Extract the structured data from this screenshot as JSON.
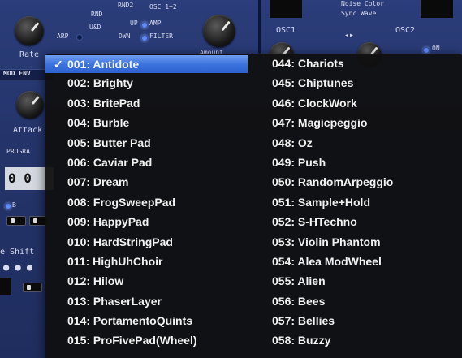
{
  "synth": {
    "rate_label": "Rate",
    "arp_label": "ARP",
    "rnd_label": "RND",
    "rnd2_label": "RND2",
    "osc12_label": "OSC 1+2",
    "ud_label": "U&D",
    "up_label": "UP",
    "amp_label": "AMP",
    "dwn_label": "DWN",
    "filter_label": "FILTER",
    "amount_label": "Amount",
    "mod_env_label": "MOD ENV",
    "attack_label": "Attack",
    "program_label": "PROGRA",
    "program_value": "0 0",
    "b_label": "B",
    "shift_label": "e Shift",
    "noise_color_label": "Noise Color",
    "sync_wave_label": "Sync Wave",
    "osc1_label": "OSC1",
    "osc2_label": "OSC2",
    "on_label": "ON"
  },
  "menu": {
    "selected_index": 0,
    "checkmark": "✓",
    "left_items": [
      "001: Antidote",
      "002: Brighty",
      "003: BritePad",
      "004: Burble",
      "005: Butter Pad",
      "006: Caviar Pad",
      "007: Dream",
      "008: FrogSweepPad",
      "009: HappyPad",
      "010: HardStringPad",
      "011: HighUhChoir",
      "012: Hilow",
      "013: PhaserLayer",
      "014: PortamentoQuints",
      "015: ProFivePad(Wheel)"
    ],
    "right_items": [
      "044: Chariots",
      "045: Chiptunes",
      "046: ClockWork",
      "047: Magicpeggio",
      "048: Oz",
      "049: Push",
      "050: RandomArpeggio",
      "051: Sample+Hold",
      "052: S-HTechno",
      "053: Violin Phantom",
      "054: Alea ModWheel",
      "055: Alien",
      "056: Bees",
      "057: Bellies",
      "058: Buzzy"
    ]
  }
}
